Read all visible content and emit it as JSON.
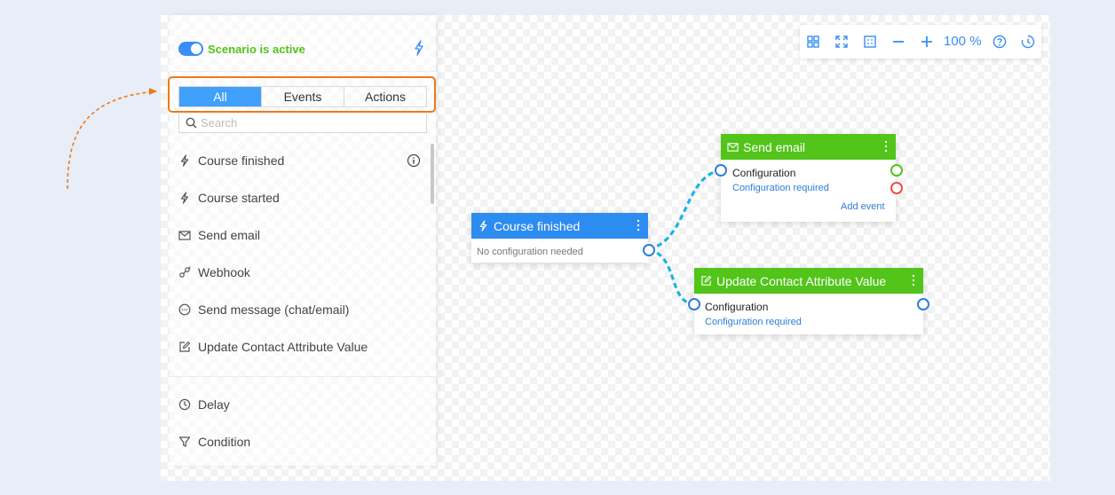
{
  "sidebar": {
    "status_label": "Scenario is active",
    "filter_tabs": [
      "All",
      "Events",
      "Actions"
    ],
    "search_placeholder": "Search",
    "items": [
      {
        "label": "Course finished",
        "icon": "bolt-icon"
      },
      {
        "label": "Course started",
        "icon": "bolt-icon"
      },
      {
        "label": "Send email",
        "icon": "envelope-icon"
      },
      {
        "label": "Webhook",
        "icon": "webhook-icon"
      },
      {
        "label": "Send message (chat/email)",
        "icon": "chat-icon"
      },
      {
        "label": "Update Contact Attribute Value",
        "icon": "edit-icon"
      }
    ],
    "logic_items": [
      {
        "label": "Delay",
        "icon": "clock-icon"
      },
      {
        "label": "Condition",
        "icon": "filter-icon"
      }
    ]
  },
  "toolbar": {
    "zoom": "100 %"
  },
  "nodes": {
    "course_finished": {
      "title": "Course finished",
      "note": "No configuration needed"
    },
    "send_email": {
      "title": "Send email",
      "config_label": "Configuration",
      "config_status": "Configuration required",
      "add_event": "Add event"
    },
    "update_attr": {
      "title": "Update Contact Attribute Value",
      "config_label": "Configuration",
      "config_status": "Configuration required"
    }
  },
  "colors": {
    "event": "#2d8cf0",
    "action": "#52c41a",
    "accent": "#3a8ef5",
    "connector": "#19b4e6",
    "highlight": "#ec7a1a"
  }
}
